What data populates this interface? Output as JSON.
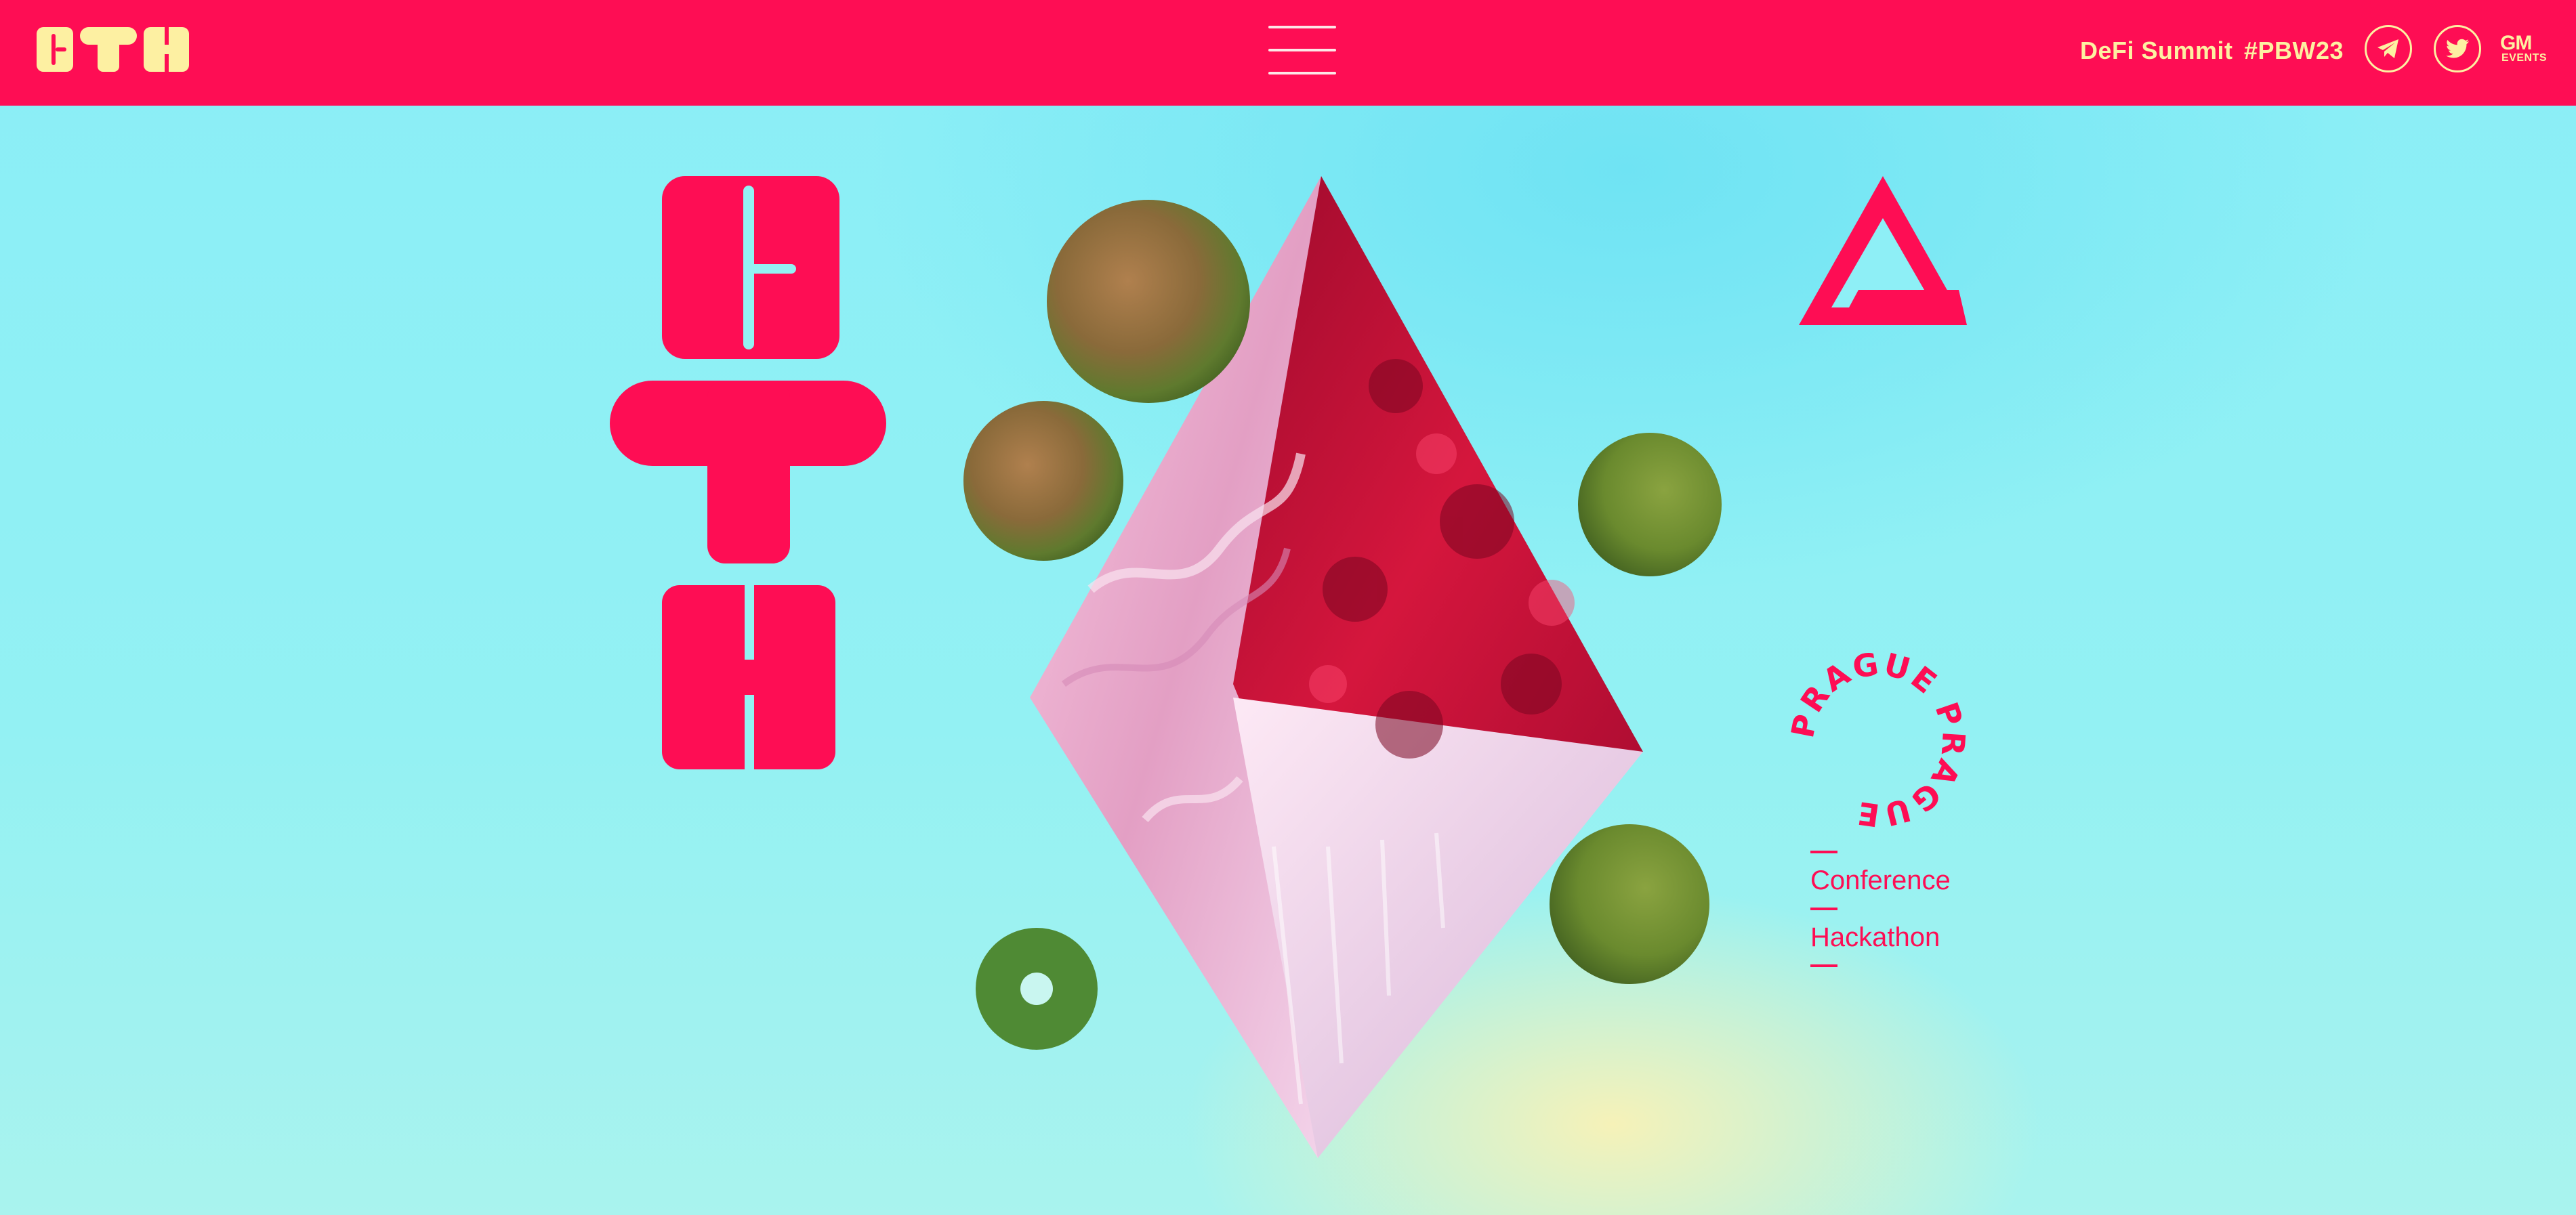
{
  "header": {
    "logo_text": "ETH",
    "menu_icon": "hamburger-icon",
    "links": [
      {
        "label": "DeFi Summit"
      },
      {
        "label": "#PBW23"
      }
    ],
    "social": [
      {
        "name": "telegram",
        "icon": "telegram-icon"
      },
      {
        "name": "twitter",
        "icon": "twitter-icon"
      }
    ],
    "partner_logo": {
      "top": "GM",
      "bottom": "EVENTS"
    }
  },
  "hero": {
    "letters": [
      "E",
      "T",
      "H"
    ],
    "seal_text": "PRAGUE PRAGUE",
    "events": [
      {
        "label": "Conference"
      },
      {
        "label": "Hackathon"
      }
    ]
  },
  "colors": {
    "brand_red": "#fe0d54",
    "brand_yellow": "#fdf0a2",
    "sky": "#8aeef7"
  }
}
